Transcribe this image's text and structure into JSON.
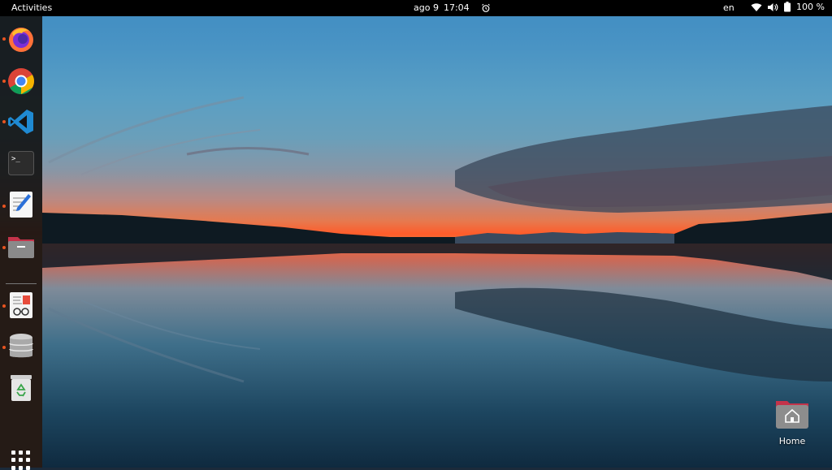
{
  "topbar": {
    "activities": "Activities",
    "date": "ago 9",
    "time": "17:04",
    "language": "en",
    "battery": "100 %"
  },
  "dock": {
    "items": [
      {
        "name": "Firefox",
        "icon": "firefox-icon",
        "running": true
      },
      {
        "name": "Google Chrome",
        "icon": "chrome-icon",
        "running": true
      },
      {
        "name": "Visual Studio Code",
        "icon": "vscode-icon",
        "running": true
      },
      {
        "name": "Terminal",
        "icon": "terminal-icon",
        "running": false
      },
      {
        "name": "Text Editor",
        "icon": "text-editor-icon",
        "running": true
      },
      {
        "name": "Files",
        "icon": "files-icon",
        "running": true
      },
      {
        "name": "Document Viewer",
        "icon": "document-viewer-icon",
        "running": true
      },
      {
        "name": "Database",
        "icon": "database-icon",
        "running": true
      },
      {
        "name": "Trash",
        "icon": "trash-icon",
        "running": false
      }
    ]
  },
  "desktop": {
    "home_label": "Home"
  },
  "colors": {
    "topbar_bg": "#000000",
    "dock_bg": "#141414",
    "running_indicator": "#e95420"
  }
}
